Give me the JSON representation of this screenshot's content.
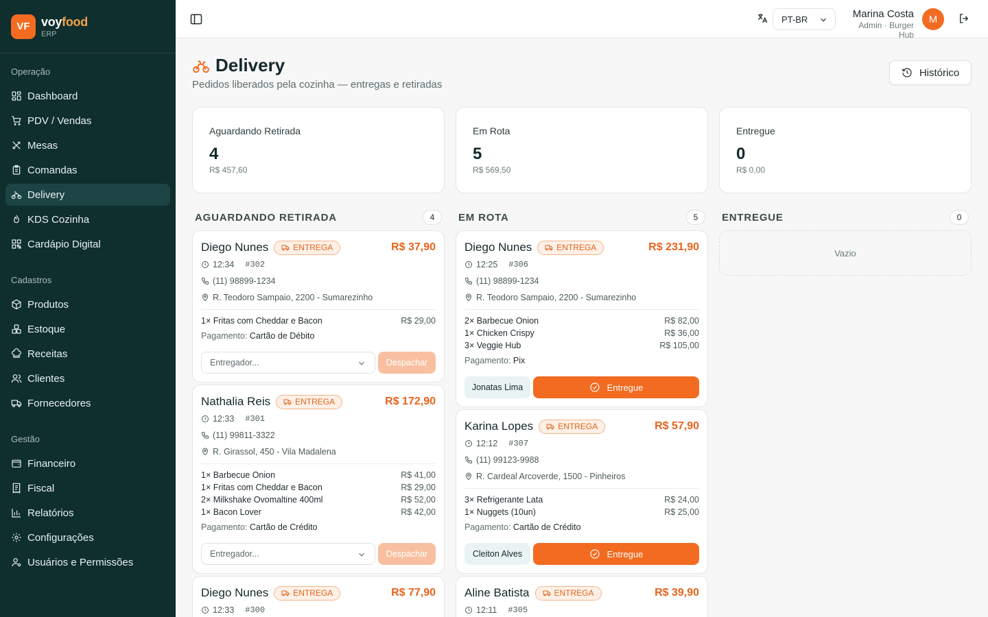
{
  "brand": {
    "initials": "VF",
    "name_part1": "voy",
    "name_part2": "food",
    "sub": "ERP"
  },
  "sidebar": {
    "sections": [
      {
        "label": "Operação",
        "items": [
          {
            "label": "Dashboard",
            "icon": "dashboard-icon"
          },
          {
            "label": "PDV / Vendas",
            "icon": "cart-icon"
          },
          {
            "label": "Mesas",
            "icon": "utensils-icon"
          },
          {
            "label": "Comandas",
            "icon": "clipboard-icon"
          },
          {
            "label": "Delivery",
            "icon": "bike-icon",
            "active": true
          },
          {
            "label": "KDS Cozinha",
            "icon": "flame-icon"
          },
          {
            "label": "Cardápio Digital",
            "icon": "qr-icon"
          }
        ]
      },
      {
        "label": "Cadastros",
        "items": [
          {
            "label": "Produtos",
            "icon": "package-icon"
          },
          {
            "label": "Estoque",
            "icon": "boxes-icon"
          },
          {
            "label": "Receitas",
            "icon": "chef-hat-icon"
          },
          {
            "label": "Clientes",
            "icon": "users-icon"
          },
          {
            "label": "Fornecedores",
            "icon": "truck-icon"
          }
        ]
      },
      {
        "label": "Gestão",
        "items": [
          {
            "label": "Financeiro",
            "icon": "wallet-icon"
          },
          {
            "label": "Fiscal",
            "icon": "receipt-icon"
          },
          {
            "label": "Relatórios",
            "icon": "bar-chart-icon"
          },
          {
            "label": "Configurações",
            "icon": "gear-icon"
          },
          {
            "label": "Usuários e Permissões",
            "icon": "user-cog-icon"
          }
        ]
      }
    ]
  },
  "topbar": {
    "language": "PT-BR",
    "user_name": "Marina Costa",
    "user_role": "Admin · Burger Hub",
    "avatar_initial": "M"
  },
  "page": {
    "title": "Delivery",
    "subtitle": "Pedidos liberados pela cozinha — entregas e retiradas",
    "history_label": "Histórico"
  },
  "stats": [
    {
      "label": "Aguardando Retirada",
      "value": "4",
      "amount": "R$ 457,60"
    },
    {
      "label": "Em Rota",
      "value": "5",
      "amount": "R$ 569,50"
    },
    {
      "label": "Entregue",
      "value": "0",
      "amount": "R$ 0,00"
    }
  ],
  "columns": {
    "waiting": {
      "title": "AGUARDANDO RETIRADA",
      "count": "4",
      "cards": [
        {
          "customer": "Diego Nunes",
          "badge": "ENTREGA",
          "total": "R$ 37,90",
          "time": "12:34",
          "order": "#302",
          "phone": "(11) 98899-1234",
          "address": "R. Teodoro Sampaio, 2200 - Sumarezinho",
          "items": [
            {
              "desc": "1× Fritas com Cheddar e Bacon",
              "price": "R$ 29,00"
            }
          ],
          "payment_label": "Pagamento:",
          "payment": "Cartão de Débito",
          "driver_placeholder": "Entregador...",
          "dispatch_label": "Despachar"
        },
        {
          "customer": "Nathalia Reis",
          "badge": "ENTREGA",
          "total": "R$ 172,90",
          "time": "12:33",
          "order": "#301",
          "phone": "(11) 99811-3322",
          "address": "R. Girassol, 450 - Vila Madalena",
          "items": [
            {
              "desc": "1× Barbecue Onion",
              "price": "R$ 41,00"
            },
            {
              "desc": "1× Fritas com Cheddar e Bacon",
              "price": "R$ 29,00"
            },
            {
              "desc": "2× Milkshake Ovomaltine 400ml",
              "price": "R$ 52,00"
            },
            {
              "desc": "1× Bacon Lover",
              "price": "R$ 42,00"
            }
          ],
          "payment_label": "Pagamento:",
          "payment": "Cartão de Crédito",
          "driver_placeholder": "Entregador...",
          "dispatch_label": "Despachar"
        },
        {
          "customer": "Diego Nunes",
          "badge": "ENTREGA",
          "total": "R$ 77,90",
          "time": "12:33",
          "order": "#300"
        }
      ]
    },
    "route": {
      "title": "EM ROTA",
      "count": "5",
      "cards": [
        {
          "customer": "Diego Nunes",
          "badge": "ENTREGA",
          "total": "R$ 231,90",
          "time": "12:25",
          "order": "#306",
          "phone": "(11) 98899-1234",
          "address": "R. Teodoro Sampaio, 2200 - Sumarezinho",
          "items": [
            {
              "desc": "2× Barbecue Onion",
              "price": "R$ 82,00"
            },
            {
              "desc": "1× Chicken Crispy",
              "price": "R$ 36,00"
            },
            {
              "desc": "3× Veggie Hub",
              "price": "R$ 105,00"
            }
          ],
          "payment_label": "Pagamento:",
          "payment": "Pix",
          "driver": "Jonatas Lima",
          "delivered_label": "Entregue"
        },
        {
          "customer": "Karina Lopes",
          "badge": "ENTREGA",
          "total": "R$ 57,90",
          "time": "12:12",
          "order": "#307",
          "phone": "(11) 99123-9988",
          "address": "R. Cardeal Arcoverde, 1500 - Pinheiros",
          "items": [
            {
              "desc": "3× Refrigerante Lata",
              "price": "R$ 24,00"
            },
            {
              "desc": "1× Nuggets (10un)",
              "price": "R$ 25,00"
            }
          ],
          "payment_label": "Pagamento:",
          "payment": "Cartão de Crédito",
          "driver": "Cleiton Alves",
          "delivered_label": "Entregue"
        },
        {
          "customer": "Aline Batista",
          "badge": "ENTREGA",
          "total": "R$ 39,90",
          "time": "12:11",
          "order": "#305"
        }
      ]
    },
    "delivered": {
      "title": "ENTREGUE",
      "count": "0",
      "empty_label": "Vazio"
    }
  },
  "colors": {
    "accent": "#f26b21",
    "sidebar_bg": "#0f2e2e",
    "sidebar_active": "#1d4444",
    "badge_bg": "#fdf0e6"
  }
}
